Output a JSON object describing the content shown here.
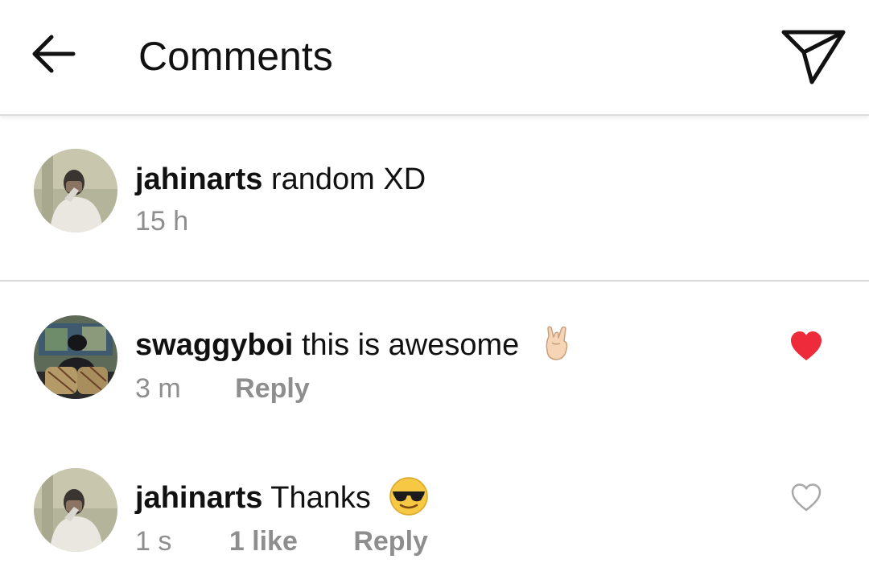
{
  "header": {
    "title": "Comments",
    "back_icon": "arrow-left-icon",
    "send_icon": "paper-plane-icon"
  },
  "caption": {
    "avatar_icon": "avatar-jahinarts",
    "username": "jahinarts",
    "text": "random XD",
    "time": "15 h"
  },
  "comments": [
    {
      "avatar_icon": "avatar-swaggyboi",
      "username": "swaggyboi",
      "text": "this is awesome",
      "emoji": "sign-of-the-horns-emoji",
      "time": "3 m",
      "reply_label": "Reply",
      "liked": true,
      "heart_color": "#ed2b3a"
    },
    {
      "avatar_icon": "avatar-jahinarts",
      "username": "jahinarts",
      "text": "Thanks",
      "emoji": "sunglasses-face-emoji",
      "time": "1 s",
      "likes_label": "1 like",
      "reply_label": "Reply",
      "liked": false
    }
  ]
}
